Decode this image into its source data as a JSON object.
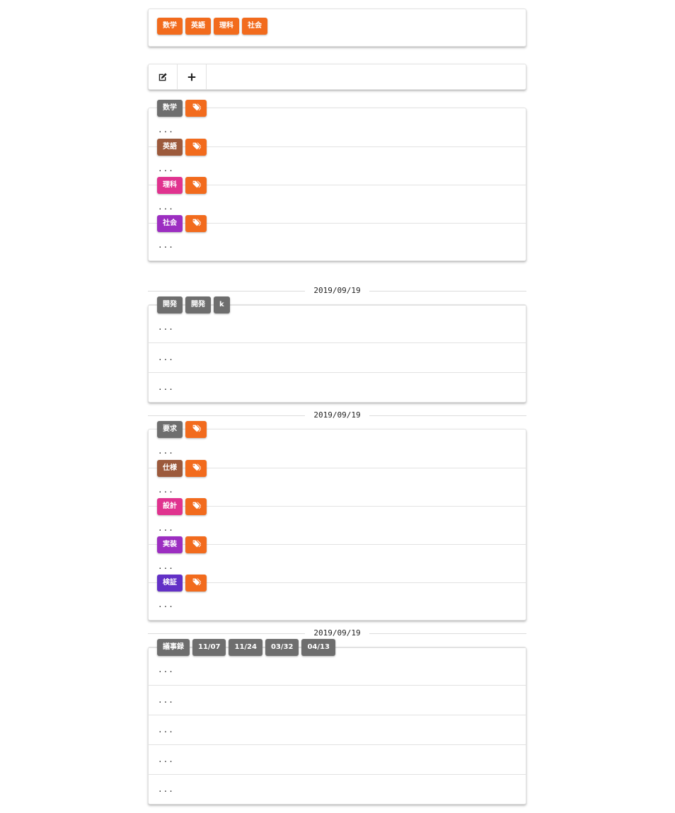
{
  "top_tags": [
    "数学",
    "英語",
    "理科",
    "社会"
  ],
  "toolbar": {
    "edit_icon": "edit-icon",
    "add_icon": "plus-icon"
  },
  "subjects": [
    {
      "label": "数学",
      "color": "#6e6e6e",
      "text": "..."
    },
    {
      "label": "英語",
      "color": "#9c5a3c",
      "text": "..."
    },
    {
      "label": "理科",
      "color": "#e0338f",
      "text": "..."
    },
    {
      "label": "社会",
      "color": "#9c2ec1",
      "text": "..."
    }
  ],
  "dev_group": {
    "date": "2019/09/19",
    "tags": [
      "開発",
      "開発",
      "k"
    ],
    "rows": [
      "...",
      "...",
      "..."
    ]
  },
  "phase_group": {
    "date": "2019/09/19",
    "sections": [
      {
        "label": "要求",
        "text": "..."
      },
      {
        "label": "仕様",
        "text": "..."
      },
      {
        "label": "設計",
        "text": "..."
      },
      {
        "label": "実装",
        "text": "..."
      },
      {
        "label": "検証",
        "text": "..."
      }
    ]
  },
  "minutes_group": {
    "date": "2019/09/19",
    "tags": [
      "議事録",
      "11/07",
      "11/24",
      "03/32",
      "04/13"
    ],
    "rows": [
      "...",
      "...",
      "...",
      "...",
      "..."
    ]
  }
}
